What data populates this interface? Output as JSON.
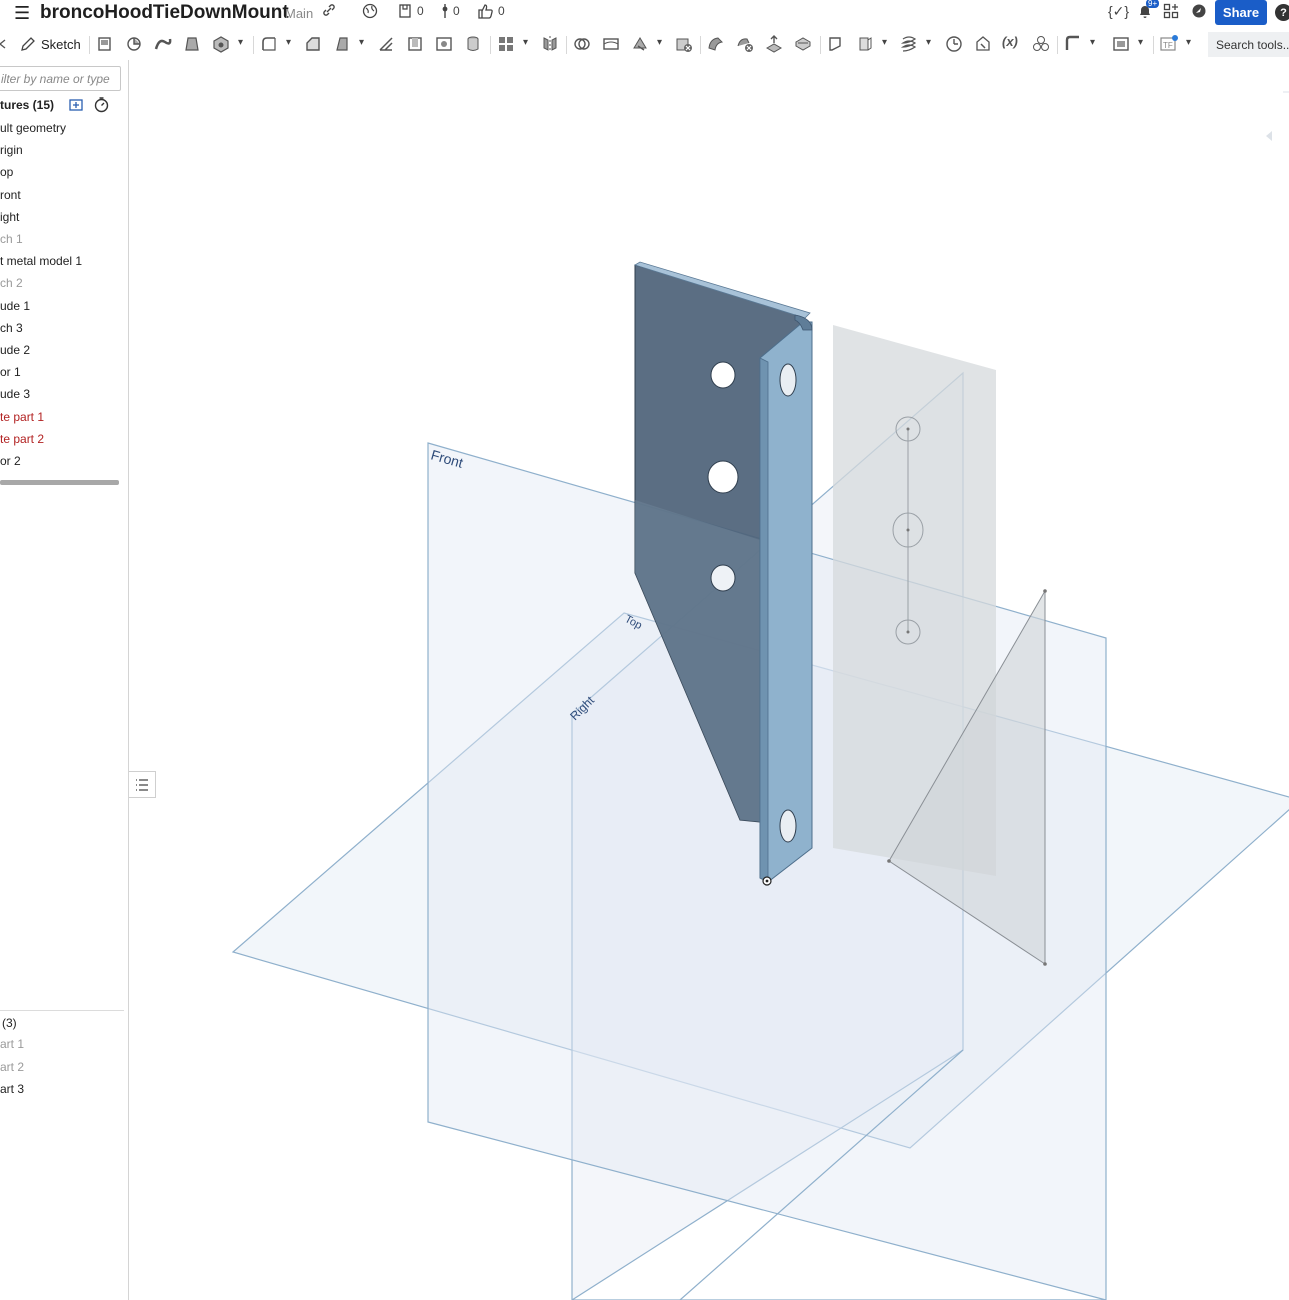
{
  "header": {
    "title": "broncoHoodTieDownMount",
    "branch": "Main",
    "versions_count": "0",
    "branches_count": "0",
    "likes_count": "0",
    "notifications_badge": "9+",
    "share_label": "Share",
    "help_label": "?"
  },
  "toolbar": {
    "sketch_label": "Sketch",
    "search_placeholder": "Search tools..."
  },
  "feature_panel": {
    "filter_placeholder": "ilter by name or type",
    "features_header": "tures (15)",
    "features": [
      {
        "label": "ult geometry",
        "state": "normal"
      },
      {
        "label": "rigin",
        "state": "normal"
      },
      {
        "label": "op",
        "state": "normal"
      },
      {
        "label": "ront",
        "state": "normal"
      },
      {
        "label": "ight",
        "state": "normal"
      },
      {
        "label": "ch 1",
        "state": "dim"
      },
      {
        "label": "t metal model 1",
        "state": "normal"
      },
      {
        "label": "ch 2",
        "state": "dim"
      },
      {
        "label": "ude 1",
        "state": "normal"
      },
      {
        "label": "ch 3",
        "state": "normal"
      },
      {
        "label": "ude 2",
        "state": "normal"
      },
      {
        "label": "or 1",
        "state": "normal"
      },
      {
        "label": "ude 3",
        "state": "normal"
      },
      {
        "label": "te part 1",
        "state": "error"
      },
      {
        "label": "te part 2",
        "state": "error"
      },
      {
        "label": "or 2",
        "state": "normal"
      }
    ],
    "parts_header": "(3)",
    "parts": [
      {
        "label": "art 1",
        "state": "dim"
      },
      {
        "label": "art 2",
        "state": "dim"
      },
      {
        "label": "art 3",
        "state": "normal"
      }
    ]
  },
  "viewport": {
    "plane_labels": {
      "front": "Front",
      "top": "Top",
      "right": "Right"
    },
    "colors": {
      "plane_stroke": "#8fb0cc",
      "plane_fill": "#e8eef6",
      "part_dark": "#4d6278",
      "part_light": "#8fb2cd",
      "sketch_plane": "#d6d9dc"
    }
  }
}
